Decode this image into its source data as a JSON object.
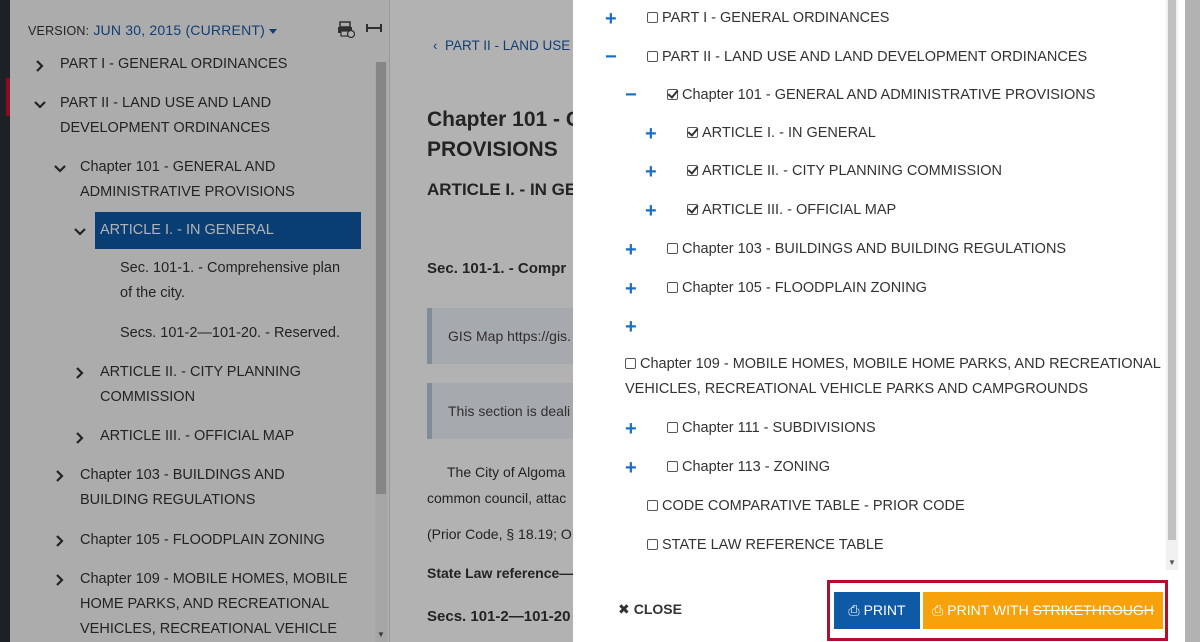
{
  "sidebar": {
    "version_label": "VERSION:",
    "version_value": "JUN 30, 2015 (CURRENT)",
    "tree": {
      "part1": "PART I - GENERAL ORDINANCES",
      "part2_line1": "PART II - LAND USE AND LAND",
      "part2_line2": "DEVELOPMENT ORDINANCES",
      "ch101_line1": "Chapter 101 - GENERAL AND",
      "ch101_line2": "ADMINISTRATIVE PROVISIONS",
      "art1": "ARTICLE I. - IN GENERAL",
      "sec1_line1": "Sec. 101-1. - Comprehensive plan",
      "sec1_line2": "of the city.",
      "secs_reserved": "Secs. 101-2—101-20. - Reserved.",
      "art2_line1": "ARTICLE II. - CITY PLANNING",
      "art2_line2": "COMMISSION",
      "art3": "ARTICLE III. - OFFICIAL MAP",
      "ch103_line1": "Chapter 103 - BUILDINGS AND",
      "ch103_line2": "BUILDING REGULATIONS",
      "ch105": "Chapter 105 - FLOODPLAIN ZONING",
      "ch109_line1": "Chapter 109 - MOBILE HOMES, MOBILE",
      "ch109_line2": "HOME PARKS, AND RECREATIONAL",
      "ch109_line3": "VEHICLES, RECREATIONAL VEHICLE"
    }
  },
  "content": {
    "breadcrumb": "PART II - LAND USE",
    "title_line1": "Chapter 101 - G",
    "title_line2": "PROVISIONS",
    "article": "ARTICLE I. - IN GE",
    "section": "Sec. 101-1. - Compr",
    "note1": "GIS Map https://gis.",
    "note2": "This section is deali",
    "para1_line1": "The City of Algoma",
    "para1_line2": "common council, attac",
    "prior_code": "(Prior Code, § 18.19; O",
    "state_law": "State Law reference—",
    "secs_heading": "Secs. 101-2—101-20"
  },
  "modal": {
    "rows": {
      "part1": "PART I - GENERAL ORDINANCES",
      "part2": "PART II - LAND USE AND LAND DEVELOPMENT ORDINANCES",
      "ch101": "Chapter 101 - GENERAL AND ADMINISTRATIVE PROVISIONS",
      "art1": "ARTICLE I. - IN GENERAL",
      "art2": "ARTICLE II. - CITY PLANNING COMMISSION",
      "art3": "ARTICLE III. - OFFICIAL MAP",
      "ch103": "Chapter 103 - BUILDINGS AND BUILDING REGULATIONS",
      "ch105": "Chapter 105 - FLOODPLAIN ZONING",
      "ch109_line1": "Chapter 109 - MOBILE HOMES, MOBILE HOME PARKS, AND RECREATIONAL",
      "ch109_line2": "VEHICLES, RECREATIONAL VEHICLE PARKS AND CAMPGROUNDS",
      "ch111": "Chapter 111 - SUBDIVISIONS",
      "ch113": "Chapter 113 - ZONING",
      "comparative": "CODE COMPARATIVE TABLE - PRIOR CODE",
      "state_law": "STATE LAW REFERENCE TABLE"
    },
    "close_label": "CLOSE",
    "print_label": "PRINT",
    "print_with_label": "PRINT WITH",
    "strikethrough_label": "STRIKETHROUGH"
  },
  "colors": {
    "accent_blue": "#0e5aa7",
    "orange": "#f7a20b",
    "highlight_red": "#b0102e"
  }
}
